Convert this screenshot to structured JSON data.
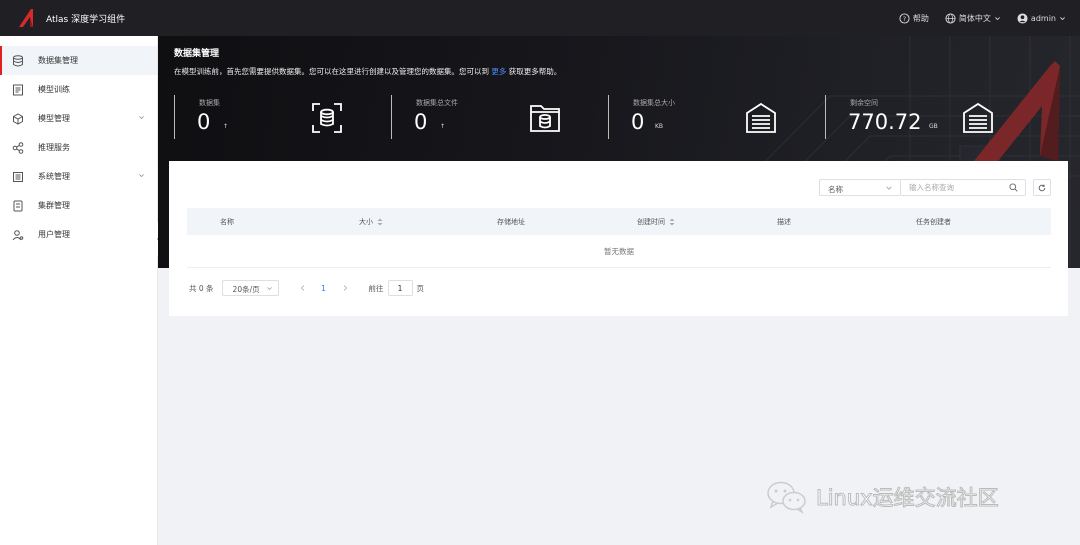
{
  "header": {
    "app_title": "Atlas 深度学习组件",
    "help_label": "帮助",
    "language_label": "简体中文",
    "user_label": "admin"
  },
  "sidebar": {
    "items": [
      {
        "label": "数据集管理",
        "icon": "database-icon",
        "active": true
      },
      {
        "label": "模型训练",
        "icon": "document-icon"
      },
      {
        "label": "模型管理",
        "icon": "cube-icon",
        "expandable": true
      },
      {
        "label": "推理服务",
        "icon": "share-icon"
      },
      {
        "label": "系统管理",
        "icon": "settings-list-icon",
        "expandable": true
      },
      {
        "label": "集群管理",
        "icon": "server-icon"
      },
      {
        "label": "用户管理",
        "icon": "user-icon"
      }
    ]
  },
  "banner": {
    "title": "数据集管理",
    "desc_prefix": "在模型训练前，首先您需要提供数据集。您可以在这里进行创建以及管理您的数据集。您可以到",
    "desc_link": "更多",
    "desc_suffix": "获取更多帮助。",
    "stats": [
      {
        "label": "数据集",
        "value": "0",
        "unit": "↑"
      },
      {
        "label": "数据集总文件",
        "value": "0",
        "unit": "↑"
      },
      {
        "label": "数据集总大小",
        "value": "0",
        "unit": "KB"
      },
      {
        "label": "剩余空间",
        "value": "770.72",
        "unit": "GB"
      }
    ]
  },
  "search": {
    "field_select": "名称",
    "placeholder": "输入名称查询"
  },
  "table": {
    "columns": [
      "名称",
      "大小",
      "存储地址",
      "创建时间",
      "描述",
      "任务创建者"
    ],
    "empty_text": "暂无数据"
  },
  "pagination": {
    "total_text": "共 0 条",
    "page_size": "20条/页",
    "current_page": "1",
    "goto_prefix": "前往",
    "goto_value": "1",
    "goto_suffix": "页"
  },
  "watermark": {
    "text": "Linux运维交流社区"
  },
  "colors": {
    "accent": "#e02020",
    "link": "#3371ff",
    "topbar": "#1f1f24"
  }
}
